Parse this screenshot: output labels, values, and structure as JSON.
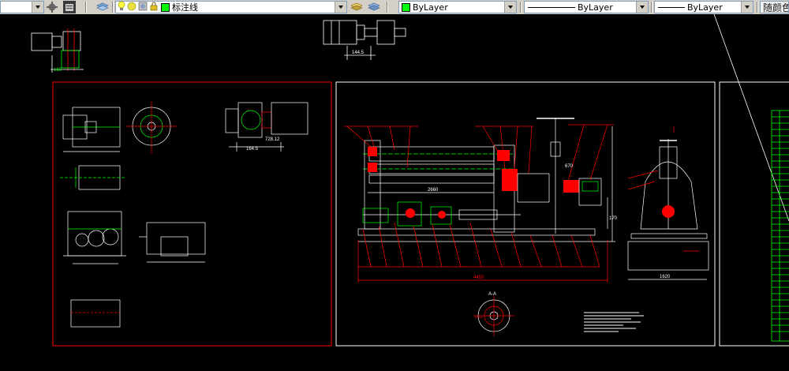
{
  "toolbar": {
    "layer_name": "标注线",
    "color_label": "ByLayer",
    "linetype_label": "ByLayer",
    "lineweight_label": "ByLayer",
    "plotstyle_label": "随颜色",
    "colors": {
      "accent_green": "#00ff00",
      "frame_red": "#ff0000",
      "drawing_green": "#00ff00"
    },
    "icons": [
      "gear-icon",
      "layer-manager-icon",
      "layers-icon",
      "bulb-icon",
      "sun-icon",
      "freeze-icon",
      "lock-icon",
      "color-swatch-icon"
    ]
  },
  "drawing": {
    "left_sheet": {
      "dimensions": [
        "160",
        "164.5",
        "728.12"
      ]
    },
    "middle_sheet": {
      "dimensions": [
        "2660",
        "670",
        "170",
        "4450"
      ],
      "section_label": "A-A"
    },
    "right_sheet": {
      "dimensions": [
        "1620"
      ]
    },
    "top_detail": {
      "dimensions": [
        "144.5"
      ]
    }
  }
}
